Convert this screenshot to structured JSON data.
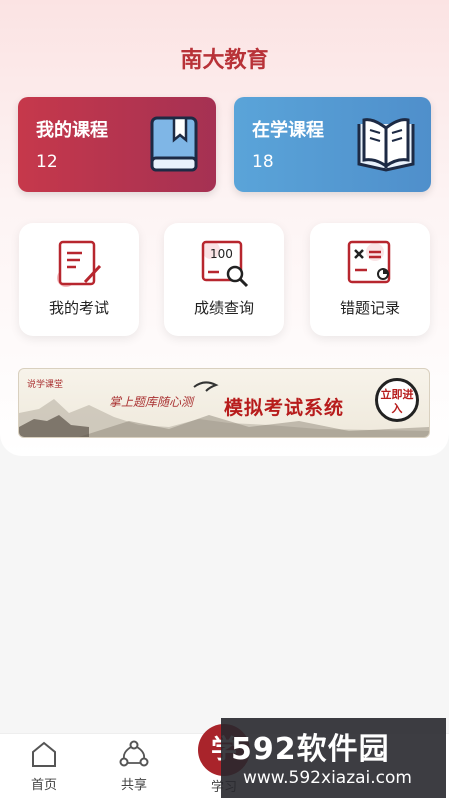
{
  "header": {
    "title": "南大教育"
  },
  "cards": [
    {
      "title": "我的课程",
      "count": "12",
      "icon": "closed-book-icon",
      "color": "#b8344f"
    },
    {
      "title": "在学课程",
      "count": "18",
      "icon": "open-book-icon",
      "color": "#5a9fd6"
    }
  ],
  "features": [
    {
      "label": "我的考试",
      "icon": "exam-paper-icon"
    },
    {
      "label": "成绩查询",
      "icon": "score-search-icon"
    },
    {
      "label": "错题记录",
      "icon": "wrong-question-icon"
    }
  ],
  "banner": {
    "logo_text": "说学课堂",
    "slogan": "掌上题库随心测",
    "main_text": "模拟考试系统",
    "cta": "立即进入"
  },
  "tabbar": {
    "items": [
      {
        "label": "首页",
        "icon": "home-icon"
      },
      {
        "label": "共享",
        "icon": "share-icon"
      },
      {
        "label": "学习",
        "icon": "study-icon"
      }
    ],
    "center_glyph": "学"
  },
  "watermark": {
    "big": "592软件园",
    "url": "www.592xiazai.com"
  },
  "colors": {
    "accent": "#b83238",
    "blue": "#5a9fd6"
  }
}
